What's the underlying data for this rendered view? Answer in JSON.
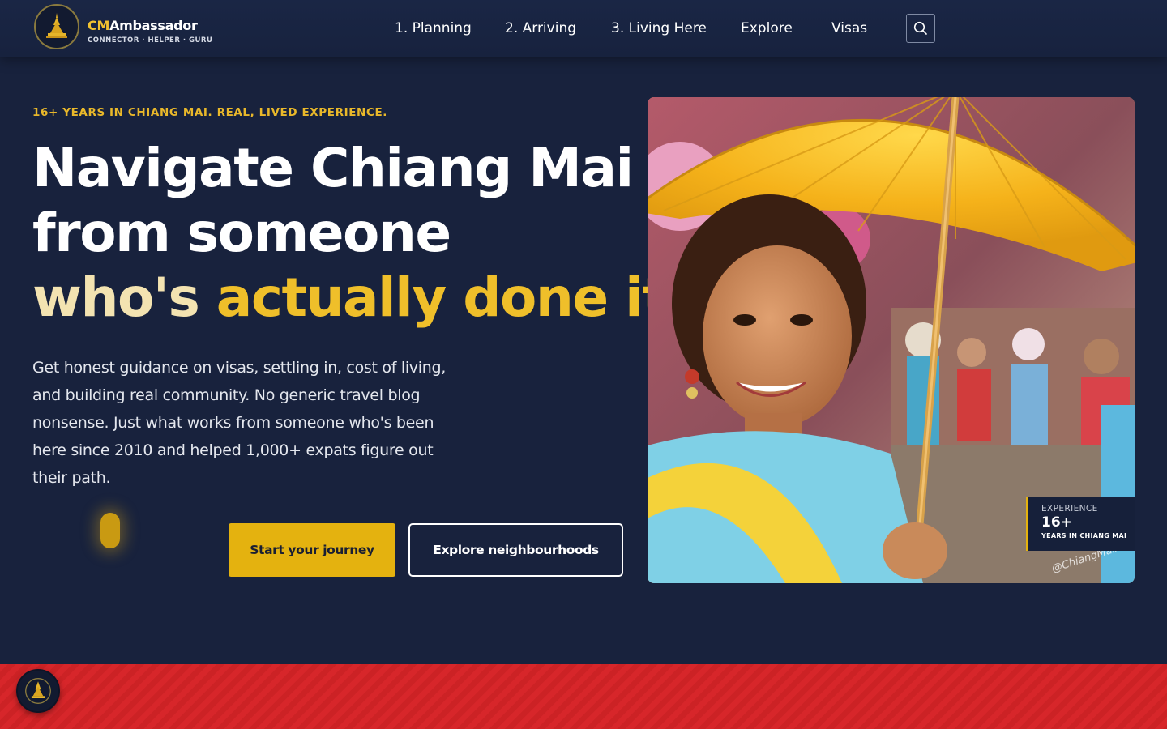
{
  "brand": {
    "name_prefix": "CM",
    "name_rest": "Ambassador",
    "tagline": "CONNECTOR · HELPER · GURU",
    "logo_icon": "stupa-icon",
    "accent_color": "#f2c230"
  },
  "nav": {
    "items": [
      {
        "label": "1. Planning"
      },
      {
        "label": "2. Arriving"
      },
      {
        "label": "3. Living Here"
      },
      {
        "label": "Explore"
      },
      {
        "label": "Visas"
      }
    ],
    "search_icon": "search-icon"
  },
  "hero": {
    "eyebrow": "16+ YEARS IN CHIANG MAI. REAL, LIVED EXPERIENCE.",
    "headline_line1": "Navigate Chiang Mai",
    "headline_line2": "from someone",
    "headline_line3_a": "who's ",
    "headline_line3_b": "actually done it.",
    "lead": "Get honest guidance on visas, settling in, cost of living, and building real community. No generic travel blog nonsense. Just what works from someone who's been here since 2010 and helped 1,000+ expats figure out their path.",
    "primary_cta": "Start your journey",
    "secondary_cta": "Explore neighbourhoods"
  },
  "experience_card": {
    "label": "EXPERIENCE",
    "value": "16+",
    "sub": "YEARS IN CHIANG MAI"
  },
  "photo": {
    "watermark": "@ChiangMaiAm",
    "description_icon": "photo-woman-with-umbrella"
  },
  "colors": {
    "background": "#18223d",
    "gold": "#e4b20f",
    "cream": "#f3e3b1",
    "band_red": "#d7262a"
  }
}
